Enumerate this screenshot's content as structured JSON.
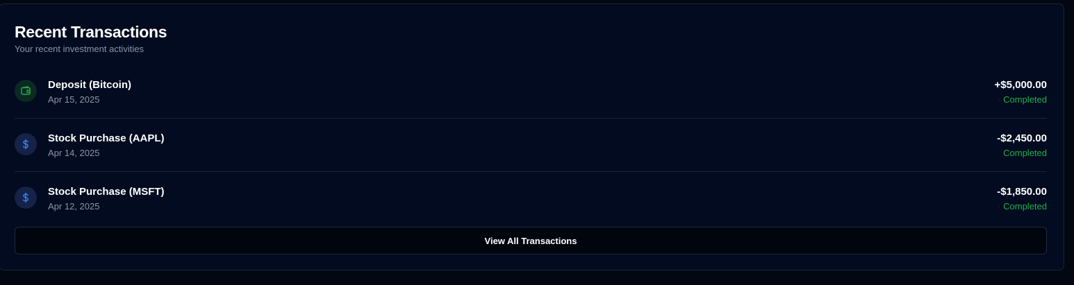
{
  "card": {
    "title": "Recent Transactions",
    "subtitle": "Your recent investment activities"
  },
  "transactions": [
    {
      "name": "Deposit (Bitcoin)",
      "date": "Apr 15, 2025",
      "amount": "+$5,000.00",
      "status": "Completed",
      "icon": "wallet-icon"
    },
    {
      "name": "Stock Purchase (AAPL)",
      "date": "Apr 14, 2025",
      "amount": "-$2,450.00",
      "status": "Completed",
      "icon": "dollar-icon"
    },
    {
      "name": "Stock Purchase (MSFT)",
      "date": "Apr 12, 2025",
      "amount": "-$1,850.00",
      "status": "Completed",
      "icon": "dollar-icon"
    }
  ],
  "actions": {
    "view_all_label": "View All Transactions"
  },
  "colors": {
    "page_background": "#030712",
    "card_background": "#020b1f",
    "status_completed": "#22b04b",
    "deposit_icon": "#22b04b",
    "purchase_icon": "#3b82f6"
  }
}
